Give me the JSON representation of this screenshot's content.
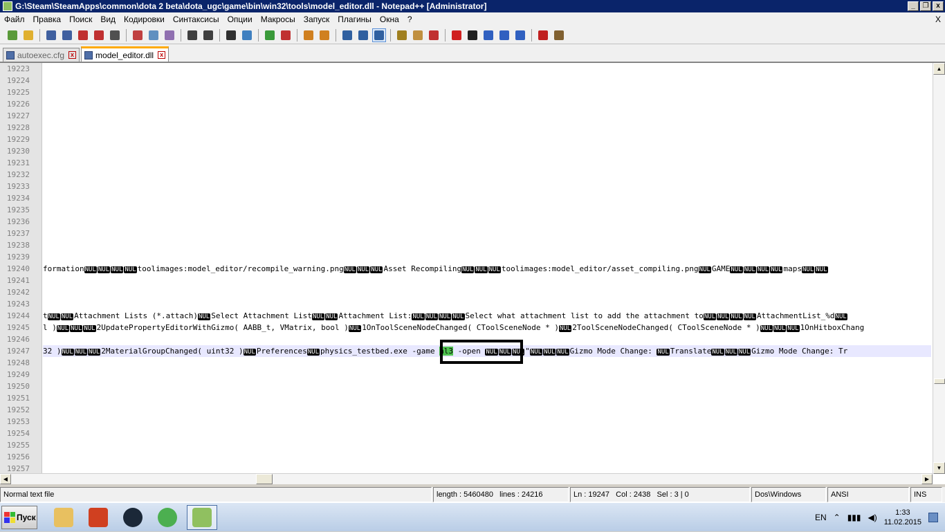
{
  "window": {
    "title": "G:\\Steam\\SteamApps\\common\\dota 2 beta\\dota_ugc\\game\\bin\\win32\\tools\\model_editor.dll - Notepad++ [Administrator]",
    "minimize": "_",
    "restore": "❐",
    "close": "x"
  },
  "menu": {
    "items": [
      "Файл",
      "Правка",
      "Поиск",
      "Вид",
      "Кодировки",
      "Синтаксисы",
      "Опции",
      "Макросы",
      "Запуск",
      "Плагины",
      "Окна",
      "?"
    ],
    "close": "X"
  },
  "toolbar": {
    "icons": [
      "new-file-icon",
      "open-file-icon",
      "save-icon",
      "save-all-icon",
      "close-file-icon",
      "close-all-icon",
      "print-icon",
      "cut-icon",
      "copy-icon",
      "paste-icon",
      "undo-icon",
      "redo-icon",
      "find-icon",
      "replace-icon",
      "zoom-in-icon",
      "zoom-out-icon",
      "sync-v-icon",
      "sync-h-icon",
      "word-wrap-icon",
      "show-all-chars-icon",
      "indent-guide-icon",
      "user-lang-icon",
      "doc-map-icon",
      "function-list-icon",
      "record-macro-icon",
      "stop-macro-icon",
      "play-macro-icon",
      "run-macro-multiple-icon",
      "save-macro-icon",
      "spell-check-icon",
      "plugin-icon"
    ],
    "colors": [
      "#5a9a3a",
      "#e0b030",
      "#4060a0",
      "#4060a0",
      "#c03030",
      "#c03030",
      "#505050",
      "#c04040",
      "#6090c0",
      "#9070b0",
      "#404040",
      "#404040",
      "#303030",
      "#4080c0",
      "#3a9a3a",
      "#c03030",
      "#d08020",
      "#d08020",
      "#3060a0",
      "#3060a0",
      "#3060a0",
      "#a08020",
      "#c09040",
      "#c03030",
      "#d02020",
      "#202020",
      "#3060c0",
      "#3060c0",
      "#3060c0",
      "#c02020",
      "#806030"
    ]
  },
  "tabs": [
    {
      "label": "autoexec.cfg",
      "active": false
    },
    {
      "label": "model_editor.dll",
      "active": true
    }
  ],
  "editor": {
    "line_numbers": [
      "19223",
      "19224",
      "19225",
      "19226",
      "19227",
      "19228",
      "19229",
      "19230",
      "19231",
      "19232",
      "19233",
      "19234",
      "19235",
      "19236",
      "19237",
      "19238",
      "19239",
      "19240",
      "19241",
      "19242",
      "19243",
      "19244",
      "19245",
      "19246",
      "19247",
      "19248",
      "19249",
      "19250",
      "19251",
      "19252",
      "19253",
      "19254",
      "19255",
      "19256",
      "19257"
    ],
    "nul_label": "NUL",
    "lines": {
      "19240": [
        "formation",
        "NUL",
        "NUL",
        "NUL",
        "NUL",
        "toolimages:model_editor/recompile_warning.png",
        "NUL",
        "NUL",
        "NUL",
        "Asset Recompiling",
        "NUL",
        "NUL",
        "NUL",
        "toolimages:model_editor/asset_compiling.png",
        "NUL",
        "GAME",
        "NUL",
        "NUL",
        "NUL",
        "NUL",
        "maps",
        "NUL",
        "NUL"
      ],
      "19244": [
        "t",
        "NUL",
        "NUL",
        "Attachment Lists (*.attach)",
        "NUL",
        "Select Attachment List",
        "NUL",
        "NUL",
        "Attachment List:",
        "NUL",
        "NUL",
        "NUL",
        "NUL",
        "Select what attachment list to add the attachment to",
        "NUL",
        "NUL",
        "NUL",
        "NUL",
        "AttachmentList_%d",
        "NUL"
      ],
      "19245": [
        "l )",
        "NUL",
        "NUL",
        "NUL",
        "2UpdatePropertyEditorWithGizmo( AABB_t, VMatrix, bool )",
        "NUL",
        "1OnToolSceneNodeChanged( CToolSceneNode * )",
        "NUL",
        "2ToolSceneNodeChanged( CToolSceneNode * )",
        "NUL",
        "NUL",
        "NUL",
        "1OnHitboxChang"
      ],
      "19247_before": [
        "32 )",
        "NUL",
        "NUL",
        "NUL",
        "2MaterialGroupChanged( uint32 )",
        "NUL",
        "Preferences",
        "NUL",
        "physics_testbed.exe -game "
      ],
      "19247_highlight": "hl3",
      "19247_after": [
        " -open ",
        "NUL",
        "NUL",
        "NUL",
        "\"",
        "NUL",
        "NUL",
        "NUL",
        "Gizmo Mode Change: ",
        "NUL",
        "Translate",
        "NUL",
        "NUL",
        "NUL",
        "Gizmo Mode Change: Tr"
      ]
    },
    "current_line": "19247"
  },
  "status": {
    "filetype": "Normal text file",
    "length": "length : 5460480",
    "lines": "lines : 24216",
    "ln": "Ln : 19247",
    "col": "Col : 2438",
    "sel": "Sel : 3 | 0",
    "eol": "Dos\\Windows",
    "encoding": "ANSI",
    "mode": "INS"
  },
  "taskbar": {
    "start_label": "Пуск",
    "apps": [
      {
        "name": "explorer-icon",
        "color": "#e8c060"
      },
      {
        "name": "ccleaner-icon",
        "color": "#d04020"
      },
      {
        "name": "steam-icon",
        "color": "#1b2838"
      },
      {
        "name": "chrome-icon",
        "color": "#4caf50"
      },
      {
        "name": "notepadpp-icon",
        "color": "#90c060"
      }
    ],
    "lang": "EN",
    "time": "1:33",
    "date": "11.02.2015"
  }
}
